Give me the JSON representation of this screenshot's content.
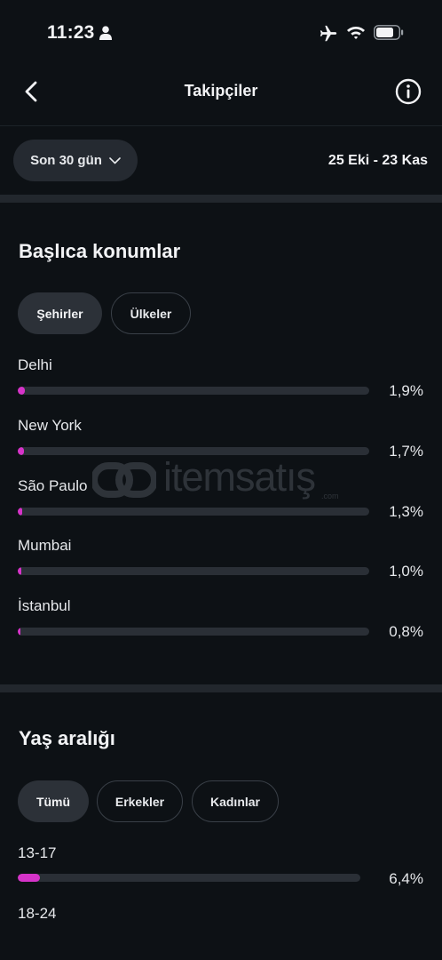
{
  "status_bar": {
    "time": "11:23"
  },
  "nav": {
    "title": "Takipçiler"
  },
  "filter": {
    "period": "Son 30 gün",
    "date_range": "25 Eki - 23 Kas"
  },
  "locations": {
    "title": "Başlıca konumlar",
    "tabs": [
      {
        "label": "Şehirler",
        "active": true
      },
      {
        "label": "Ülkeler",
        "active": false
      }
    ],
    "rows": [
      {
        "name": "Delhi",
        "value": "1,9%",
        "percent": 1.9
      },
      {
        "name": "New York",
        "value": "1,7%",
        "percent": 1.7
      },
      {
        "name": "São Paulo",
        "value": "1,3%",
        "percent": 1.3
      },
      {
        "name": "Mumbai",
        "value": "1,0%",
        "percent": 1.0
      },
      {
        "name": "İstanbul",
        "value": "0,8%",
        "percent": 0.8
      }
    ]
  },
  "age": {
    "title": "Yaş aralığı",
    "tabs": [
      {
        "label": "Tümü",
        "active": true
      },
      {
        "label": "Erkekler",
        "active": false
      },
      {
        "label": "Kadınlar",
        "active": false
      }
    ],
    "rows": [
      {
        "name": "13-17",
        "value": "6,4%",
        "percent": 6.4
      },
      {
        "name": "18-24"
      }
    ]
  },
  "watermark": {
    "text": "itemsatış",
    "sub": ".com"
  },
  "colors": {
    "background": "#0d1115",
    "accent": "#d633c9",
    "track": "#2a2f36"
  }
}
